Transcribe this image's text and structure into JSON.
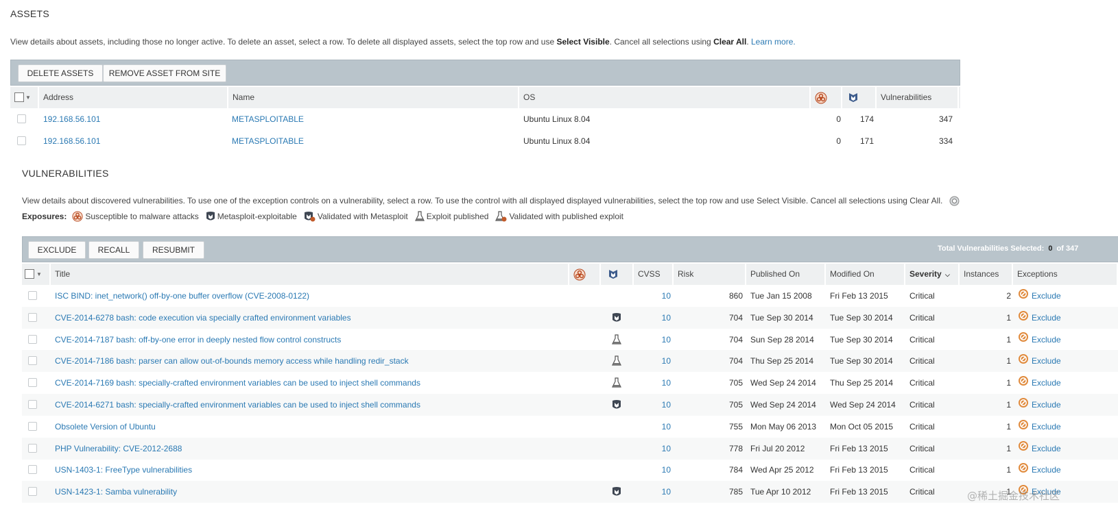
{
  "assets": {
    "title": "ASSETS",
    "description": {
      "part1": "View details about assets, including those no longer active. To delete an asset, select a row. To delete all displayed assets, select the top row and use ",
      "select_visible": "Select Visible",
      "part2": ". Cancel all selections using ",
      "clear_all": "Clear All",
      "part3": ". ",
      "learn_more": "Learn more."
    },
    "buttons": {
      "delete": "DELETE ASSETS",
      "remove": "REMOVE ASSET FROM SITE"
    },
    "columns": {
      "address": "Address",
      "name": "Name",
      "os": "OS",
      "vulnerabilities": "Vulnerabilities"
    },
    "rows": [
      {
        "address": "192.168.56.101",
        "name": "METASPLOITABLE",
        "os": "Ubuntu Linux 8.04",
        "malware": "0",
        "exploits": "174",
        "vulns": "347"
      },
      {
        "address": "192.168.56.101",
        "name": "METASPLOITABLE",
        "os": "Ubuntu Linux 8.04",
        "malware": "0",
        "exploits": "171",
        "vulns": "334"
      }
    ]
  },
  "vulnerabilities": {
    "title": "VULNERABILITIES",
    "description": "View details about discovered vulnerabilities. To use one of the exception controls on a vulnerability, select a row. To use the control with all displayed displayed vulnerabilities, select the top row and use Select Visible. Cancel all selections using Clear All.",
    "exposures": {
      "label": "Exposures:",
      "items": {
        "malware": "Susceptible to malware attacks",
        "metasploit": "Metasploit-exploitable",
        "validated_metasploit": "Validated with Metasploit",
        "exploit_published": "Exploit published",
        "validated_published": "Validated with published exploit"
      }
    },
    "buttons": {
      "exclude": "EXCLUDE",
      "recall": "RECALL",
      "resubmit": "RESUBMIT"
    },
    "selected": {
      "label": "Total Vulnerabilities Selected:",
      "count": "0",
      "of": "of 347"
    },
    "columns": {
      "title": "Title",
      "cvss": "CVSS",
      "risk": "Risk",
      "published": "Published On",
      "modified": "Modified On",
      "severity": "Severity",
      "instances": "Instances",
      "exceptions": "Exceptions"
    },
    "exclude_label": "Exclude",
    "rows": [
      {
        "title": "ISC BIND: inet_network() off-by-one buffer overflow (CVE-2008-0122)",
        "icon": "",
        "cvss": "10",
        "risk": "860",
        "published": "Tue Jan 15 2008",
        "modified": "Fri Feb 13 2015",
        "severity": "Critical",
        "instances": "2"
      },
      {
        "title": "CVE-2014-6278 bash: code execution via specially crafted environment variables",
        "icon": "metasploit",
        "cvss": "10",
        "risk": "704",
        "published": "Tue Sep 30 2014",
        "modified": "Tue Sep 30 2014",
        "severity": "Critical",
        "instances": "1"
      },
      {
        "title": "CVE-2014-7187 bash: off-by-one error in deeply nested flow control constructs",
        "icon": "exploit",
        "cvss": "10",
        "risk": "704",
        "published": "Sun Sep 28 2014",
        "modified": "Tue Sep 30 2014",
        "severity": "Critical",
        "instances": "1"
      },
      {
        "title": "CVE-2014-7186 bash: parser can allow out-of-bounds memory access while handling redir_stack",
        "icon": "exploit",
        "cvss": "10",
        "risk": "704",
        "published": "Thu Sep 25 2014",
        "modified": "Tue Sep 30 2014",
        "severity": "Critical",
        "instances": "1"
      },
      {
        "title": "CVE-2014-7169 bash: specially-crafted environment variables can be used to inject shell commands",
        "icon": "exploit",
        "cvss": "10",
        "risk": "705",
        "published": "Wed Sep 24 2014",
        "modified": "Thu Sep 25 2014",
        "severity": "Critical",
        "instances": "1"
      },
      {
        "title": "CVE-2014-6271 bash: specially-crafted environment variables can be used to inject shell commands",
        "icon": "metasploit",
        "cvss": "10",
        "risk": "705",
        "published": "Wed Sep 24 2014",
        "modified": "Wed Sep 24 2014",
        "severity": "Critical",
        "instances": "1"
      },
      {
        "title": "Obsolete Version of Ubuntu",
        "icon": "",
        "cvss": "10",
        "risk": "755",
        "published": "Mon May 06 2013",
        "modified": "Mon Oct 05 2015",
        "severity": "Critical",
        "instances": "1"
      },
      {
        "title": "PHP Vulnerability: CVE-2012-2688",
        "icon": "",
        "cvss": "10",
        "risk": "778",
        "published": "Fri Jul 20 2012",
        "modified": "Fri Feb 13 2015",
        "severity": "Critical",
        "instances": "1"
      },
      {
        "title": "USN-1403-1: FreeType vulnerabilities",
        "icon": "",
        "cvss": "10",
        "risk": "784",
        "published": "Wed Apr 25 2012",
        "modified": "Fri Feb 13 2015",
        "severity": "Critical",
        "instances": "1"
      },
      {
        "title": "USN-1423-1: Samba vulnerability",
        "icon": "metasploit",
        "cvss": "10",
        "risk": "785",
        "published": "Tue Apr 10 2012",
        "modified": "Fri Feb 13 2015",
        "severity": "Critical",
        "instances": "1"
      }
    ]
  },
  "watermark": "@稀土掘金技术社区",
  "colors": {
    "link": "#2a79b3",
    "toolbar": "#b9c4cb",
    "header": "#eef0f1",
    "exclude_icon": "#e08a3c"
  }
}
